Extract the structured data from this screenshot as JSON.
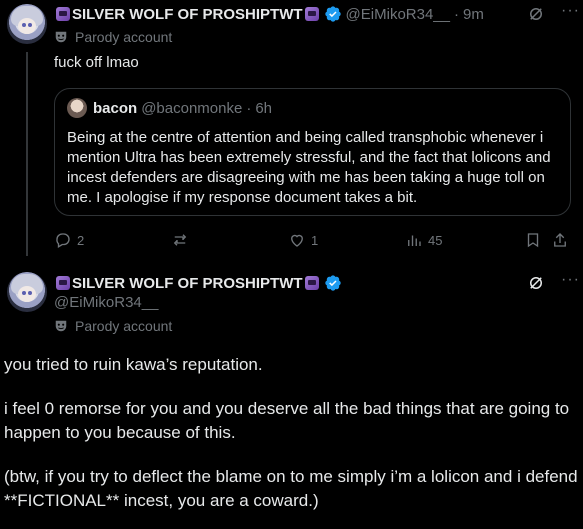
{
  "reply": {
    "author_name": "SILVER WOLF OF PROSHIPTWT",
    "handle": "@EiMikoR34__",
    "time": "9m",
    "parody_label": "Parody account",
    "text": "fuck off lmao",
    "quote": {
      "author_name": "bacon",
      "handle": "@baconmonke",
      "time": "6h",
      "text": "Being at the centre of attention and being called transphobic whenever i mention Ultra has been extremely stressful, and the fact that lolicons and incest defenders are disagreeing with me has been taking a huge toll on me. I apologise if my response document takes a bit."
    },
    "actions": {
      "replies": "2",
      "reposts": "",
      "likes": "1",
      "views": "45"
    }
  },
  "main": {
    "author_name": "SILVER WOLF OF PROSHIPTWT",
    "handle": "@EiMikoR34__",
    "parody_label": "Parody account",
    "paragraphs": [
      "you tried to ruin kawa’s reputation.",
      "i feel 0 remorse for you and you deserve all the bad things that are going to happen to you because of this.",
      "(btw, if you try to deflect the blame on to me simply i’m a lolicon and i defend **FICTIONAL** incest, you are a coward.)"
    ]
  },
  "colors": {
    "background": "#000000",
    "text": "#e7e9ea",
    "muted": "#71767b",
    "verified": "#1d9bf0",
    "border": "#2f3336"
  }
}
